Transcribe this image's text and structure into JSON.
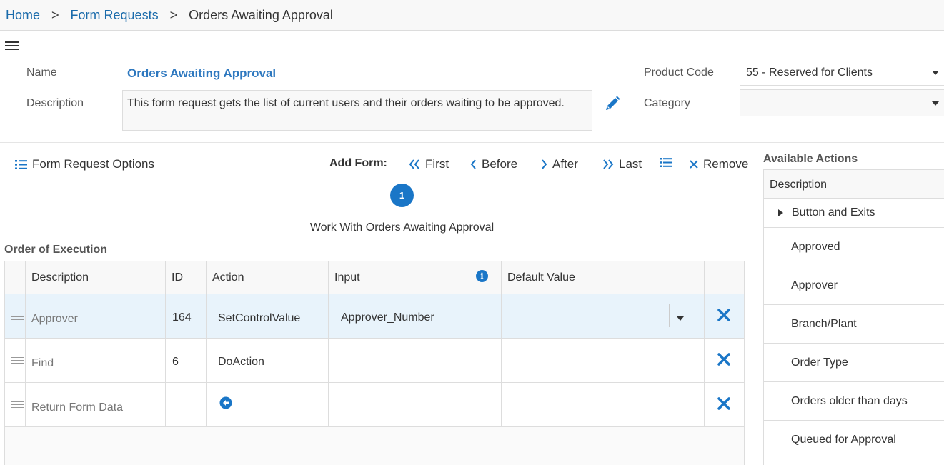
{
  "breadcrumb": {
    "home": "Home",
    "separator": ">",
    "form_requests": "Form Requests",
    "current": "Orders Awaiting Approval"
  },
  "form": {
    "name_label": "Name",
    "name_value": "Orders Awaiting Approval",
    "description_label": "Description",
    "description_value": "This form request gets the list of current users and their orders waiting to be approved.",
    "product_code_label": "Product Code",
    "product_code_value": "55 - Reserved for Clients",
    "category_label": "Category",
    "category_value": ""
  },
  "toolbar": {
    "options_label": "Form Request Options",
    "add_form_label": "Add Form:",
    "first_label": "First",
    "before_label": "Before",
    "after_label": "After",
    "last_label": "Last",
    "remove_label": "Remove"
  },
  "step": {
    "number": "1",
    "title": "Work With Orders Awaiting Approval"
  },
  "execution": {
    "title": "Order of Execution",
    "columns": [
      "Description",
      "ID",
      "Action",
      "Input",
      "Default Value"
    ],
    "rows": [
      {
        "description": "Approver",
        "id": "164",
        "action": "SetControlValue",
        "input": "Approver_Number",
        "default_value": ""
      },
      {
        "description": "Find",
        "id": "6",
        "action": "DoAction",
        "input": "",
        "default_value": ""
      },
      {
        "description": "Return Form Data",
        "id": "",
        "action": "",
        "input": "",
        "default_value": ""
      }
    ]
  },
  "available_actions": {
    "title": "Available Actions",
    "header": "Description",
    "group": "Button and Exits",
    "items": [
      "Approved",
      "Approver",
      "Branch/Plant",
      "Order Type",
      "Orders older than days",
      "Queued for Approval"
    ]
  },
  "colors": {
    "accent": "#1a76c7",
    "link": "#1a6bab",
    "selected_row": "#e8f3fb"
  },
  "icons": {
    "menu": "hamburger-icon",
    "edit": "pencil-icon",
    "list": "list-icon",
    "first": "double-chevron-left-icon",
    "before": "chevron-left-icon",
    "after": "chevron-right-icon",
    "last": "double-chevron-right-icon",
    "remove": "close-icon",
    "info": "info-icon",
    "delete": "delete-x-icon",
    "return": "return-arrow-icon"
  }
}
